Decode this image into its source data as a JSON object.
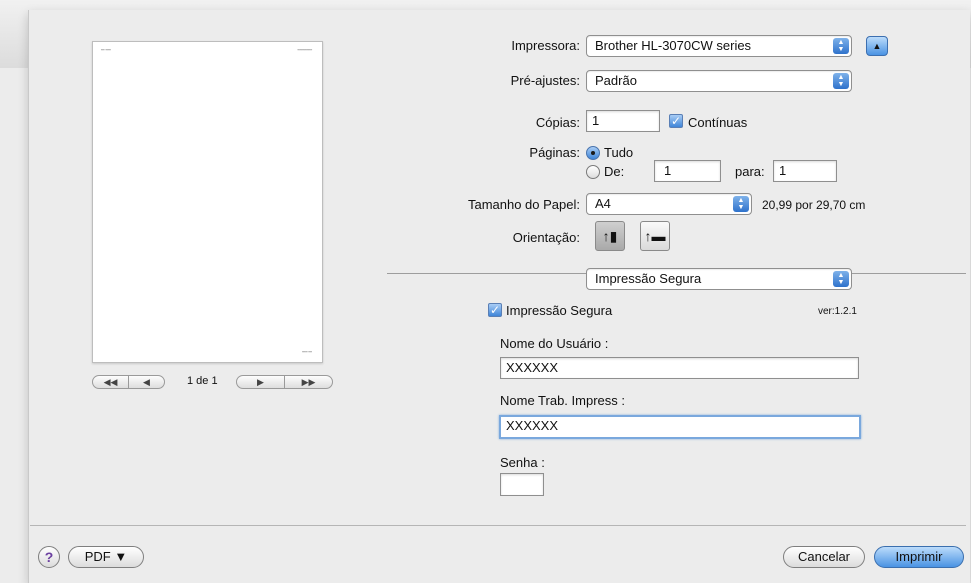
{
  "printer": {
    "label": "Impressora:",
    "value": "Brother HL-3070CW series"
  },
  "presets": {
    "label": "Pré-ajustes:",
    "value": "Padrão"
  },
  "copies": {
    "label": "Cópias:",
    "value": "1",
    "collated_label": "Contínuas"
  },
  "pages": {
    "label": "Páginas:",
    "all_label": "Tudo",
    "from_label": "De:",
    "from_value": "1",
    "to_label": "para:",
    "to_value": "1"
  },
  "paper_size": {
    "label": "Tamanho do Papel:",
    "value": "A4",
    "dimensions": "20,99 por 29,70 cm"
  },
  "orientation": {
    "label": "Orientação:"
  },
  "section_popup": {
    "value": "Impressão Segura"
  },
  "secure": {
    "checkbox_label": "Impressão Segura",
    "version": "ver:1.2.1",
    "username_label": "Nome do Usuário :",
    "username_value": "XXXXXX",
    "jobname_label": "Nome Trab. Impress :",
    "jobname_value": "XXXXXX",
    "password_label": "Senha :",
    "password_value": ""
  },
  "preview": {
    "page_indicator": "1 de 1"
  },
  "footer": {
    "help_symbol": "?",
    "pdf_label": "PDF ▼",
    "cancel_label": "Cancelar",
    "print_label": "Imprimir"
  }
}
